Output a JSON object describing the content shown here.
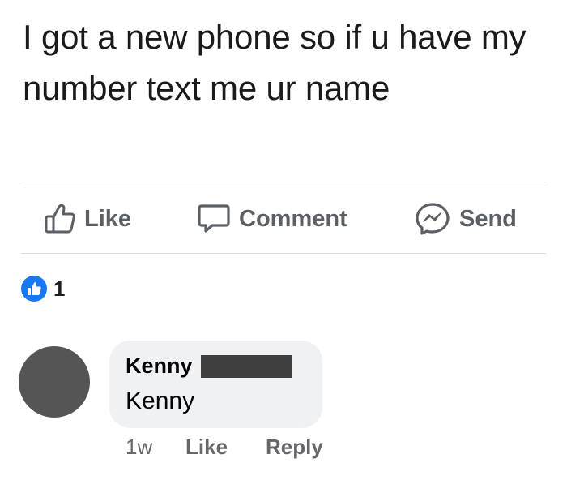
{
  "post": {
    "text": "I got a new phone so if u have my number text me ur name"
  },
  "actions": {
    "like_label": "Like",
    "comment_label": "Comment",
    "send_label": "Send",
    "like_icon": "thumbs-up-outline-icon",
    "comment_icon": "speech-bubble-icon",
    "send_icon": "messenger-icon",
    "color": "#5b5f66"
  },
  "reactions": {
    "icon": "thumbs-up-badge-icon",
    "count": "1",
    "badge_color": "#1877f2"
  },
  "comment": {
    "author": "Kenny",
    "author_surname_redacted": true,
    "body": "Kenny",
    "time": "1w",
    "like_label": "Like",
    "reply_label": "Reply",
    "bubble_color": "#eff1f4",
    "avatar_color": "#555555"
  }
}
